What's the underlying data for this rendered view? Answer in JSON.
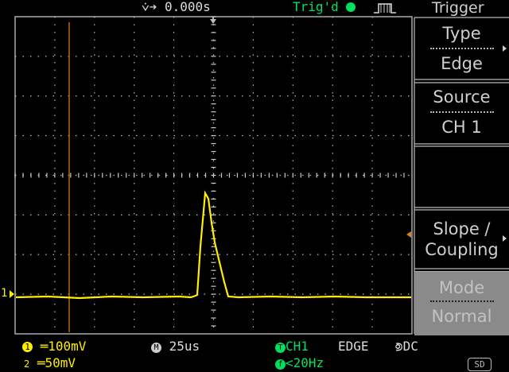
{
  "header": {
    "h_position": "0.000s",
    "trigger_status": "Trig'd",
    "menu_title": "Trigger"
  },
  "menu": {
    "type_label": "Type",
    "type_value": "Edge",
    "source_label": "Source",
    "source_value": "CH 1",
    "slope_label_1": "Slope /",
    "slope_label_2": "Coupling",
    "mode_label": "Mode",
    "mode_value": "Normal"
  },
  "footer": {
    "ch1_scale": "100mV",
    "ch2_scale": "50mV",
    "timebase": "25us",
    "trigger_source": "CH1",
    "trigger_type": "EDGE",
    "trigger_coupling": "DC",
    "trigger_freq": "<20Hz",
    "sd_badge": "SD"
  },
  "markers": {
    "ch1_marker": "1"
  },
  "colors": {
    "ch1": "#ffee00",
    "trigger": "#00e060",
    "grid": "#bbbbbb",
    "panel_bg": "#000000",
    "menu_border": "#9a9a9a"
  }
}
